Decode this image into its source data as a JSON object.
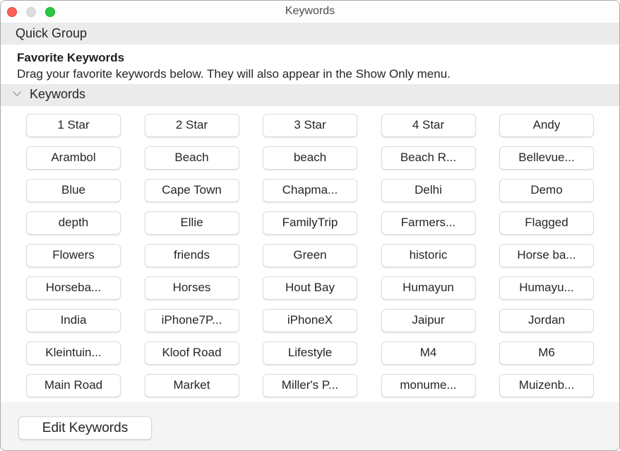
{
  "window": {
    "title": "Keywords",
    "controls": {
      "close": "close-button",
      "minimize": "minimize-button",
      "zoom": "zoom-button"
    },
    "colors": {
      "close": "#fe5f57",
      "minimize": "#dddddd",
      "zoom": "#28c840",
      "section_header_bg": "#ebebeb",
      "footer_bg": "#f4f4f4"
    }
  },
  "quick_group": {
    "label": "Quick Group"
  },
  "favorites": {
    "title": "Favorite Keywords",
    "description": "Drag your favorite keywords below. They will also appear in the Show Only menu."
  },
  "keywords_section": {
    "label": "Keywords",
    "disclosure_icon": "chevron-down-icon",
    "expanded": true,
    "items": [
      "1 Star",
      "2 Star",
      "3 Star",
      "4 Star",
      "Andy",
      "Arambol",
      "Beach",
      "beach",
      "Beach R...",
      "Bellevue...",
      "Blue",
      "Cape Town",
      "Chapma...",
      "Delhi",
      "Demo",
      "depth",
      "Ellie",
      "FamilyTrip",
      "Farmers...",
      "Flagged",
      "Flowers",
      "friends",
      "Green",
      "historic",
      "Horse ba...",
      "Horseba...",
      "Horses",
      "Hout Bay",
      "Humayun",
      "Humayu...",
      "India",
      "iPhone7P...",
      "iPhoneX",
      "Jaipur",
      "Jordan",
      "Kleintuin...",
      "Kloof Road",
      "Lifestyle",
      "M4",
      "M6",
      "Main Road",
      "Market",
      "Miller's P...",
      "monume...",
      "Muizenb..."
    ]
  },
  "footer": {
    "edit_keywords_label": "Edit Keywords"
  }
}
